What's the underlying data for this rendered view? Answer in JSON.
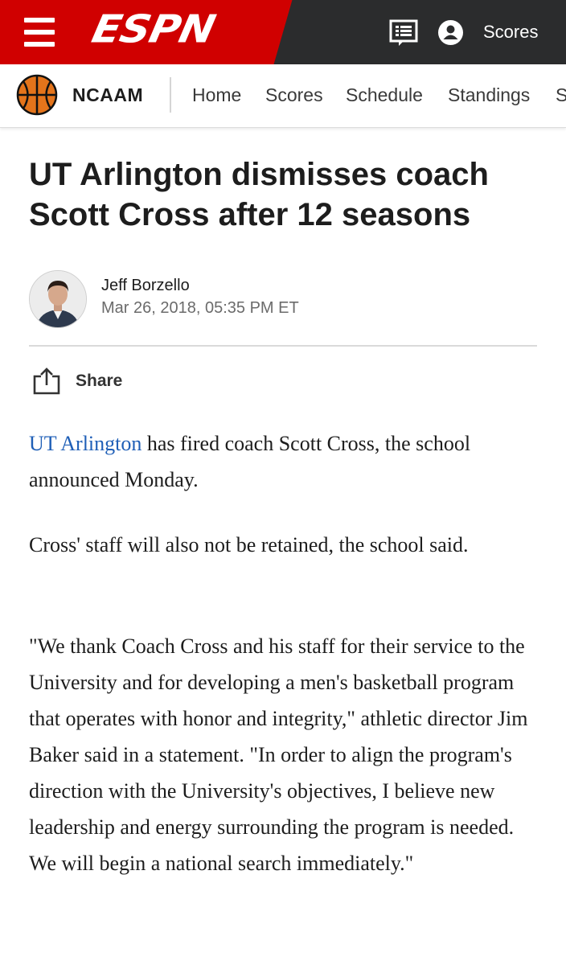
{
  "header": {
    "brand": "ESPN",
    "scores_label": "Scores",
    "brand_color": "#d00000"
  },
  "subnav": {
    "league": "NCAAM",
    "items": [
      "Home",
      "Scores",
      "Schedule",
      "Standings",
      "S"
    ]
  },
  "article": {
    "headline": "UT Arlington dismisses coach Scott Cross after 12 seasons",
    "author": "Jeff Borzello",
    "timestamp": "Mar 26, 2018, 05:35 PM ET",
    "share_label": "Share",
    "paragraphs": [
      {
        "link": "UT Arlington",
        "text": " has fired coach Scott Cross, the school announced Monday."
      },
      {
        "text": "Cross' staff will also not be retained, the school said."
      },
      {
        "text": "\"We thank Coach Cross and his staff for their service to the University and for developing a men's basketball program that operates with honor and integrity,\" athletic director Jim Baker said in a statement. \"In order to align the program's direction with the University's objectives, I believe new leadership and energy surrounding the program is needed. We will begin a national search immediately.\""
      }
    ]
  }
}
